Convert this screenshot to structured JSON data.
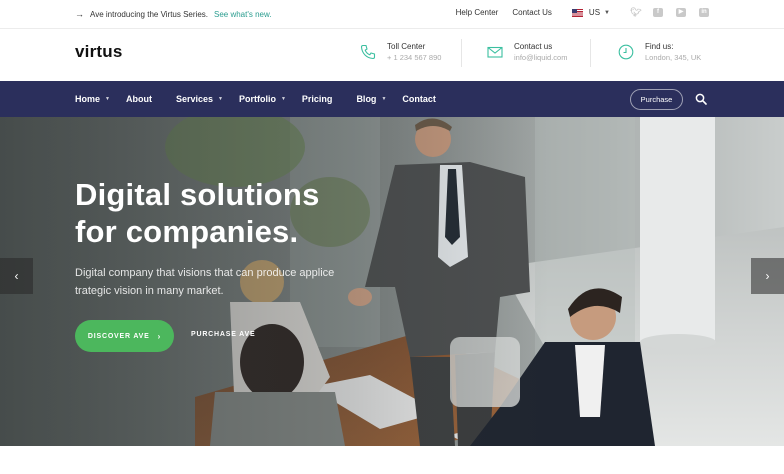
{
  "topbar": {
    "announcement_text": "Ave introducing the Virtus Series.",
    "announcement_link": "See what's new.",
    "help_center": "Help Center",
    "contact_us": "Contact Us",
    "language": "US",
    "social_icons": [
      "twitter-icon",
      "facebook-icon",
      "youtube-icon",
      "linkedin-icon"
    ]
  },
  "header": {
    "logo": "virtus",
    "contacts": [
      {
        "icon": "phone-icon",
        "title": "Toll Center",
        "detail": "+ 1 234 567 890"
      },
      {
        "icon": "envelope-icon",
        "title": "Contact us",
        "detail": "info@liquid.com"
      },
      {
        "icon": "clock-icon",
        "title": "Find us:",
        "detail": "London, 345, UK"
      }
    ]
  },
  "nav": {
    "items": [
      {
        "label": "Home",
        "dropdown": true
      },
      {
        "label": "About",
        "dropdown": false
      },
      {
        "label": "Services",
        "dropdown": true
      },
      {
        "label": "Portfolio",
        "dropdown": true
      },
      {
        "label": "Pricing",
        "dropdown": false
      },
      {
        "label": "Blog",
        "dropdown": true
      },
      {
        "label": "Contact",
        "dropdown": false
      }
    ],
    "purchase_button": "Purchase",
    "search_icon": "search-icon"
  },
  "hero": {
    "title_line1": "Digital solutions",
    "title_line2": "for companies.",
    "subtitle_line1": "Digital company that visions that can produce applice",
    "subtitle_line2": "trategic vision in many market.",
    "primary_button": "DISCOVER AVE",
    "secondary_button": "PURCHASE AVE"
  },
  "colors": {
    "accent_teal": "#2a9d8f",
    "nav_bg": "#2b2f5c",
    "button_green": "#4cb75d",
    "icon_green": "#3bbfa0"
  }
}
